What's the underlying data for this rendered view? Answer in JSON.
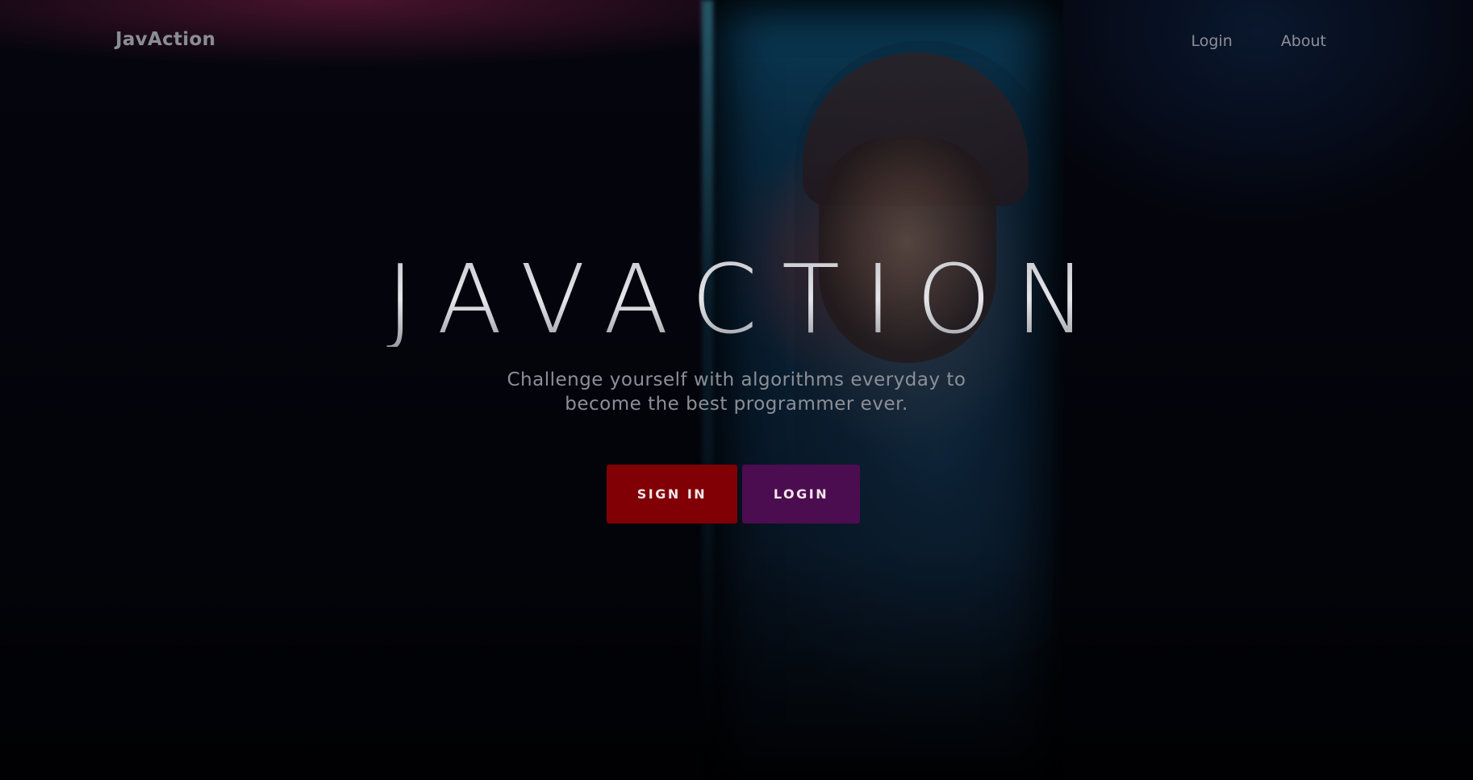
{
  "nav": {
    "brand": "JavAction",
    "links": [
      "Login",
      "About"
    ]
  },
  "hero": {
    "title": "JAVACTION",
    "subtitle_line1": "Challenge yourself with algorithms everyday to",
    "subtitle_line2": "become the best programmer ever.",
    "sign_in_label": "SIGN IN",
    "login_label": "LOGIN"
  },
  "colors": {
    "sign_in_button": "#800005",
    "login_button": "#4c0c50",
    "background": "#03040b"
  }
}
